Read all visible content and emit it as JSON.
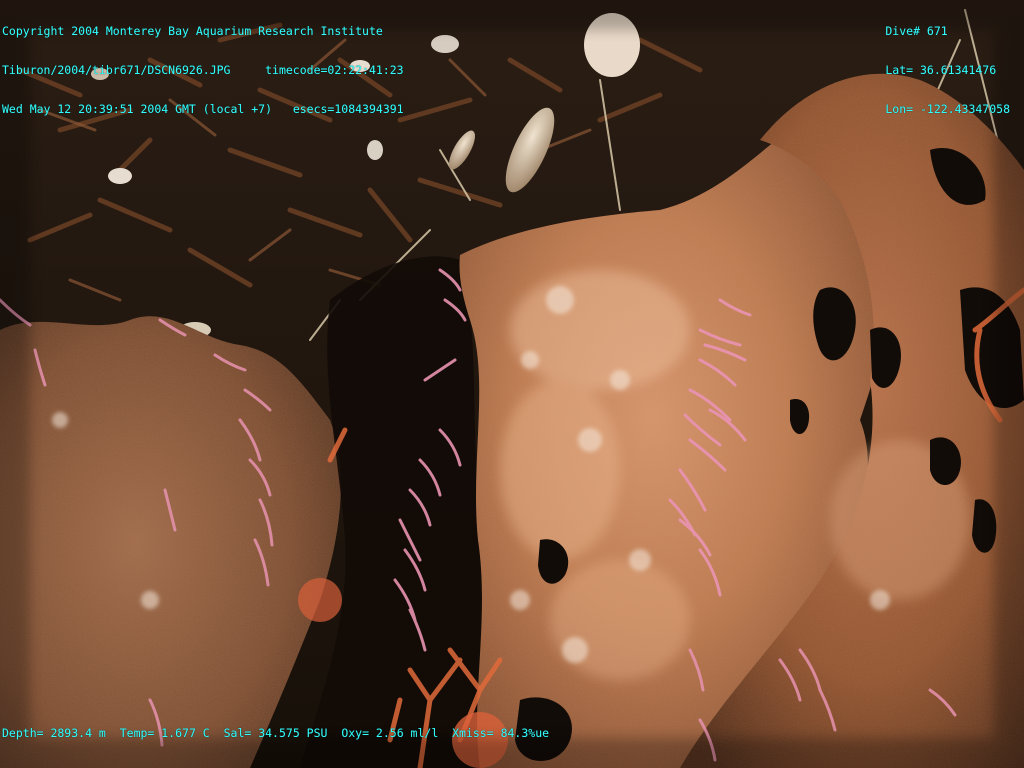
{
  "overlay": {
    "top_left": {
      "copyright": "Copyright 2004 Monterey Bay Aquarium Research Institute",
      "file_path": "Tiburon/2004/tibr671/DSCN6926.JPG",
      "timecode": "timecode=02:22:41:23",
      "date": "Wed May 12 20:39:51 2004 GMT (local +7)",
      "esecs": "esecs=1084394391"
    },
    "top_right": {
      "dive": "Dive# 671",
      "lat": "Lat= 36.61341476",
      "lon": "Lon= -122.43347058"
    },
    "bottom": {
      "depth": "Depth= 2893.4 m",
      "temp": "Temp= 1.677 C",
      "salinity": "Sal= 34.575 PSU",
      "oxygen": "Oxy= 2.56 ml/l",
      "xmiss": "Xmiss= 84.3%ue"
    },
    "text_color": "#33ffff"
  },
  "scene": {
    "subject": "deep-sea seafloor with rust-colored rock, dark sediment, shells and pink tube worms",
    "colors": {
      "sediment": "#1f1610",
      "rock_light": "#c98457",
      "rock_mid": "#9b5a35",
      "rock_dark": "#5a3520",
      "worm_pink": "#e58aa6",
      "shadow": "#0d0907"
    }
  }
}
